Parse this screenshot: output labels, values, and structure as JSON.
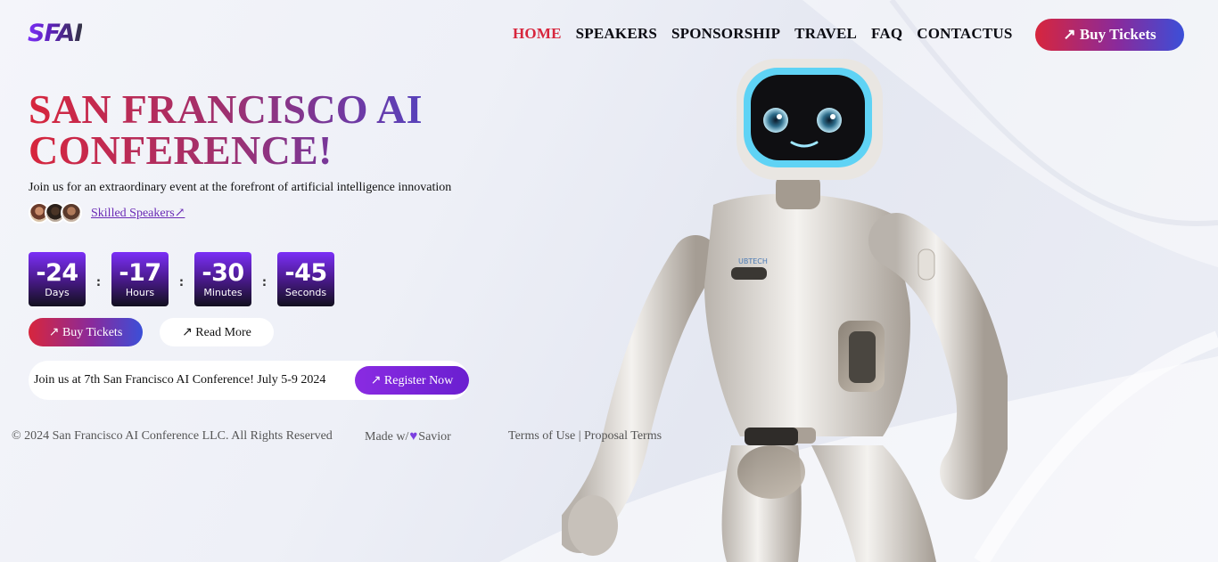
{
  "brand": {
    "logo_text": "SFAI"
  },
  "nav": {
    "items": [
      {
        "label": "HOME",
        "active": true
      },
      {
        "label": "SPEAKERS",
        "active": false
      },
      {
        "label": "SPONSORSHIP",
        "active": false
      },
      {
        "label": "TRAVEL",
        "active": false
      },
      {
        "label": "FAQ",
        "active": false
      },
      {
        "label": "CONTACTUS",
        "active": false
      }
    ],
    "buy_tickets_label": "↗ Buy Tickets"
  },
  "hero": {
    "title_line1": "SAN FRANCISCO AI",
    "title_line2": "CONFERENCE!",
    "subtitle": "Join us for an extraordinary event at the forefront of artificial intelligence innovation",
    "speakers_link": "Skilled Speakers↗"
  },
  "countdown": {
    "days": {
      "value": "-24",
      "label": "Days"
    },
    "hours": {
      "value": "-17",
      "label": "Hours"
    },
    "minutes": {
      "value": "-30",
      "label": "Minutes"
    },
    "seconds": {
      "value": "-45",
      "label": "Seconds"
    },
    "separator": ":"
  },
  "actions": {
    "buy_tickets": "↗ Buy Tickets",
    "read_more": "↗ Read More"
  },
  "register": {
    "text": "Join us at 7th San Francisco AI Conference! July 5-9 2024",
    "button": "↗ Register Now"
  },
  "footer": {
    "copyright": "© 2024 San Francisco AI Conference LLC. All Rights Reserved",
    "made_prefix": "Made w/",
    "made_suffix": "Savior",
    "terms": "Terms of Use | Proposal Terms"
  },
  "colors": {
    "accent_red": "#d7263d",
    "accent_purple": "#7b2ff7",
    "accent_blue": "#3b4fd8"
  }
}
